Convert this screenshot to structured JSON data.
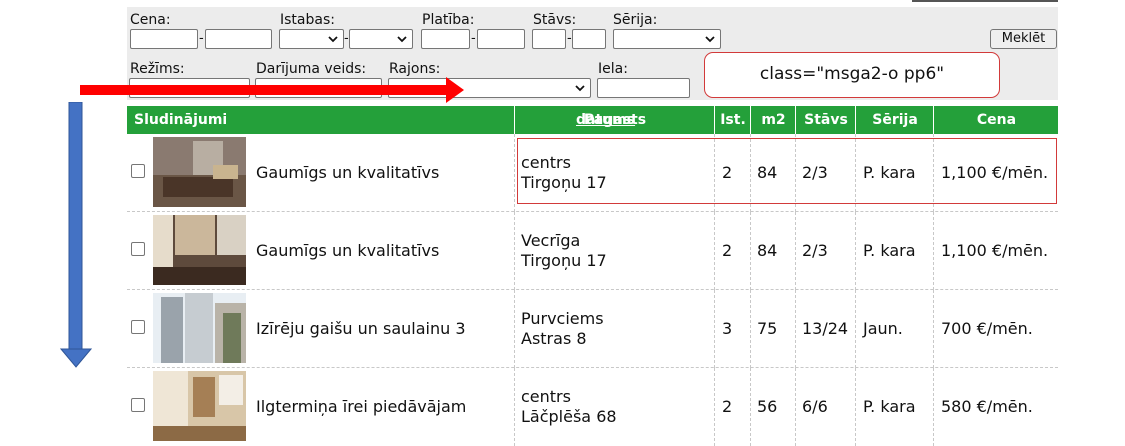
{
  "filters": {
    "cena_label": "Cena:",
    "istabas_label": "Istabas:",
    "platiba_label": "Platība:",
    "stavs_label": "Stāvs:",
    "serija_label": "Sērija:",
    "rezims_label": "Režīms:",
    "darijuma_label": "Darījuma veids:",
    "rajons_label": "Rajons:",
    "iela_label": "Iela:",
    "search_button": "Meklēt"
  },
  "annotation": {
    "callout_text": "class=\"msga2-o pp6\"",
    "arrow_right_color": "#ff0000",
    "arrow_down_color": "#4472c4"
  },
  "table": {
    "header_color": "#24a03a",
    "headers": {
      "sludinajumi": "Sludinājumi",
      "datums": "datums",
      "pagasts": "Pagasts",
      "ist": "Ist.",
      "m2": "m2",
      "stavs": "Stāvs",
      "serija": "Sērija",
      "cena": "Cena"
    },
    "rows": [
      {
        "title": "Gaumīgs un kvalitatīvs",
        "district": "centrs",
        "street": "Tirgoņu 17",
        "rooms": "2",
        "area": "84",
        "floor": "2/3",
        "series": "P. kara",
        "price": "1,100 €/mēn."
      },
      {
        "title": "Gaumīgs un kvalitatīvs",
        "district": "Vecrīga",
        "street": "Tirgoņu 17",
        "rooms": "2",
        "area": "84",
        "floor": "2/3",
        "series": "P. kara",
        "price": "1,100 €/mēn."
      },
      {
        "title": "Izīrēju gaišu un saulainu 3",
        "district": "Purvciems",
        "street": "Astras 8",
        "rooms": "3",
        "area": "75",
        "floor": "13/24",
        "series": "Jaun.",
        "price": "700 €/mēn."
      },
      {
        "title": "Ilgtermiņa īrei piedāvājam",
        "district": "centrs",
        "street": "Lāčplēša 68",
        "rooms": "2",
        "area": "56",
        "floor": "6/6",
        "series": "P. kara",
        "price": "580 €/mēn."
      }
    ]
  }
}
